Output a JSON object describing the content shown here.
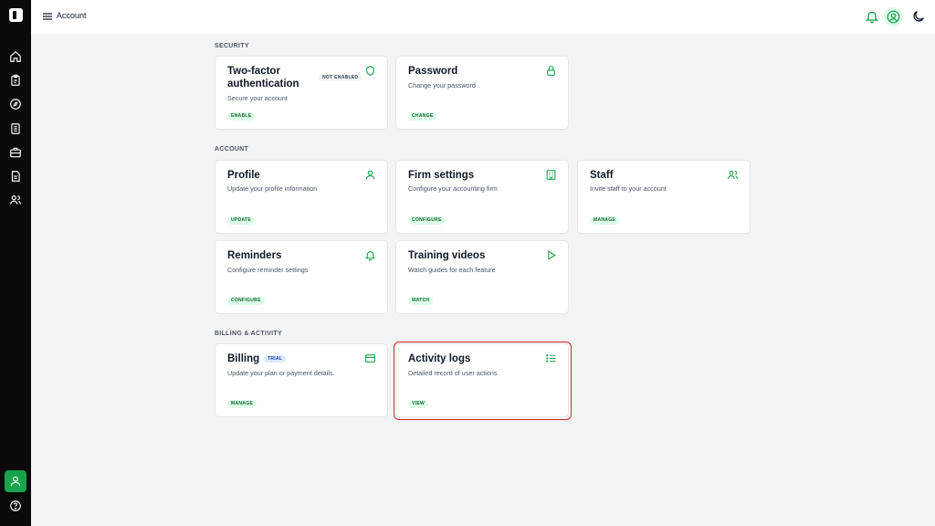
{
  "header": {
    "title": "Account"
  },
  "sidebar": {
    "icons": [
      "home-icon",
      "clipboard-icon",
      "compass-icon",
      "checklist-icon",
      "briefcase-icon",
      "document-icon",
      "users-icon"
    ],
    "footer_icons": [
      "user-icon",
      "help-icon"
    ]
  },
  "sections": {
    "security": {
      "label": "SECURITY",
      "two_factor": {
        "title_line1": "Two-factor",
        "title_line2": "authentication",
        "badge": "NOT ENABLED",
        "description": "Secure your account",
        "action": "ENABLE",
        "icon": "shield-icon"
      },
      "password": {
        "title": "Password",
        "description": "Change your password",
        "action": "CHANGE",
        "icon": "lock-icon"
      }
    },
    "account": {
      "label": "ACCOUNT",
      "profile": {
        "title": "Profile",
        "description": "Update your profile information",
        "action": "UPDATE",
        "icon": "user-icon"
      },
      "firm_settings": {
        "title": "Firm settings",
        "description": "Configure your accounting firm",
        "action": "CONFIGURE",
        "icon": "building-icon"
      },
      "staff": {
        "title": "Staff",
        "description": "Invite staff to your account",
        "action": "MANAGE",
        "icon": "users-icon"
      },
      "reminders": {
        "title": "Reminders",
        "description": "Configure reminder settings",
        "action": "CONFIGURE",
        "icon": "bell-icon"
      },
      "training_videos": {
        "title": "Training videos",
        "description": "Watch guides for each feature",
        "action": "WATCH",
        "icon": "play-icon"
      }
    },
    "billing_activity": {
      "label": "BILLING & ACTIVITY",
      "billing": {
        "title": "Billing",
        "badge": "TRIAL",
        "description": "Update your plan or payment details.",
        "action": "MANAGE",
        "icon": "credit-card-icon"
      },
      "activity_logs": {
        "title": "Activity logs",
        "description": "Detailed record of user actions",
        "action": "VIEW",
        "icon": "list-icon"
      }
    }
  },
  "colors": {
    "accent": "#16a34a",
    "highlight": "#dc2626",
    "sidebar": "#0a0a0a"
  }
}
